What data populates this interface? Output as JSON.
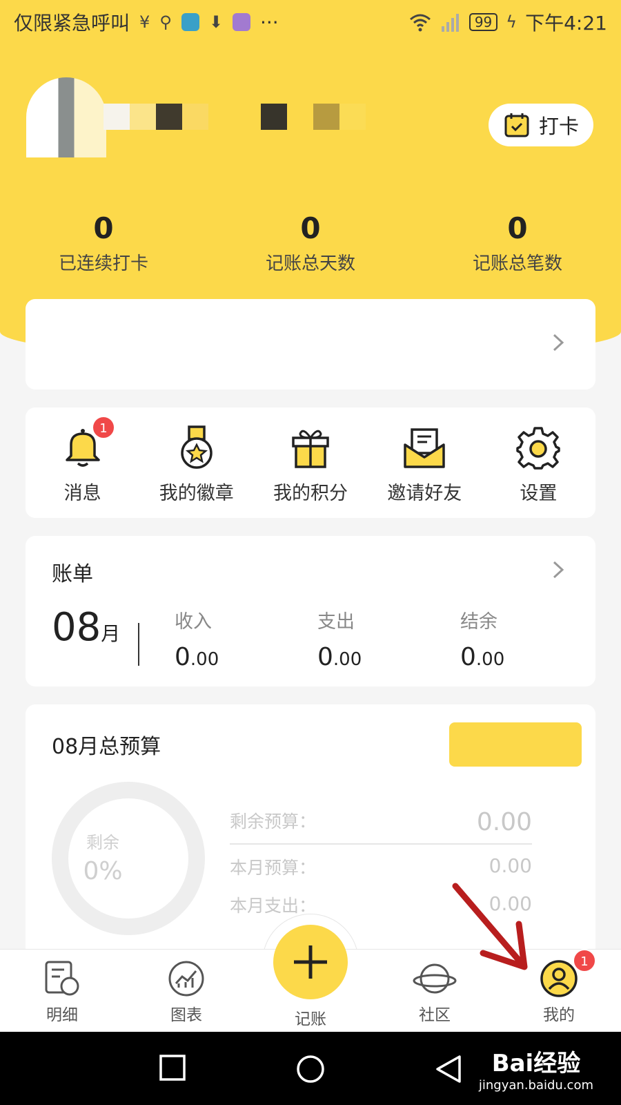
{
  "status_bar": {
    "left_text": "仅限紧急呼叫",
    "more": "···",
    "battery": "99",
    "time": "下午4:21"
  },
  "profile": {
    "checkin_label": "打卡"
  },
  "stats": [
    {
      "value": "0",
      "label": "已连续打卡"
    },
    {
      "value": "0",
      "label": "记账总天数"
    },
    {
      "value": "0",
      "label": "记账总笔数"
    }
  ],
  "menu": [
    {
      "label": "消息",
      "icon": "bell-icon",
      "badge": "1"
    },
    {
      "label": "我的徽章",
      "icon": "medal-icon"
    },
    {
      "label": "我的积分",
      "icon": "gift-icon"
    },
    {
      "label": "邀请好友",
      "icon": "envelope-icon"
    },
    {
      "label": "设置",
      "icon": "gear-icon"
    }
  ],
  "bill": {
    "title": "账单",
    "month": "08",
    "month_unit": "月",
    "columns": [
      {
        "label": "收入",
        "int": "0",
        "dec": ".00"
      },
      {
        "label": "支出",
        "int": "0",
        "dec": ".00"
      },
      {
        "label": "结余",
        "int": "0",
        "dec": ".00"
      }
    ]
  },
  "budget": {
    "title": "08月总预算",
    "ring_label": "剩余",
    "ring_value": "0%",
    "rows": [
      {
        "label": "剩余预算：",
        "value": "0.00"
      },
      {
        "label": "本月预算：",
        "value": "0.00"
      },
      {
        "label": "本月支出：",
        "value": "0.00"
      }
    ]
  },
  "tabs": [
    {
      "label": "明细",
      "icon": "detail-icon"
    },
    {
      "label": "图表",
      "icon": "chart-icon"
    },
    {
      "label": "记账",
      "icon": "plus-icon"
    },
    {
      "label": "社区",
      "icon": "planet-icon"
    },
    {
      "label": "我的",
      "icon": "user-icon",
      "badge": "1"
    }
  ],
  "watermark": {
    "brand": "Bai经验",
    "url": "jingyan.baidu.com"
  },
  "colors": {
    "accent": "#fcd94a",
    "badge": "#f04848",
    "arrow": "#b81e1e"
  }
}
